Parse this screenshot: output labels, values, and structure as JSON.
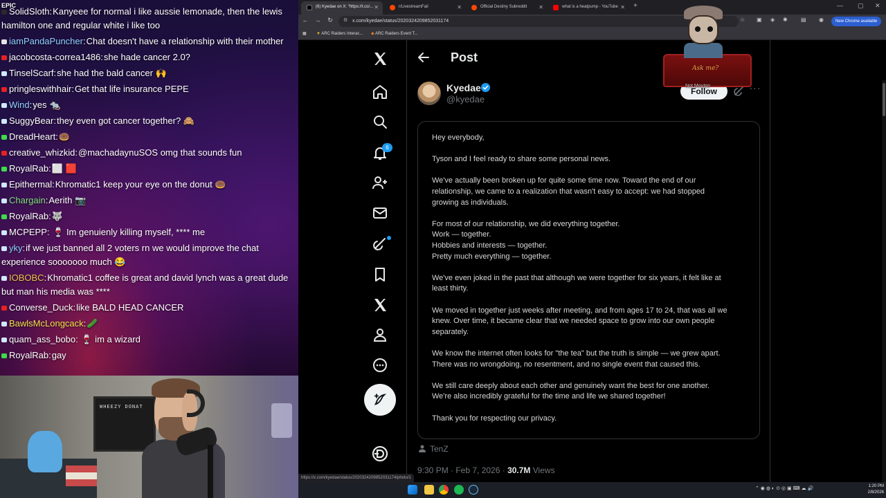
{
  "chat": {
    "badge": "EPIC\nEpic Games",
    "messages": [
      {
        "user": "SolidSloth",
        "text": "Kanyeee for normal i like aussie lemonade, then the lewis hamilton one and regular white i like too",
        "user_color": "#ffffff",
        "dot_color": "#2a2a2a"
      },
      {
        "user": "iamPandaPuncher",
        "text": "Chat doesn't have a relationship with their mother",
        "user_color": "#8fd0ff",
        "dot_color": "#e4e4e4"
      },
      {
        "user": "jacobcosta-correa1486",
        "text": "she hade cancer 2.0?",
        "user_color": "#ffffff",
        "dot_color": "#e52222"
      },
      {
        "user": "TinselScarf",
        "text": "she had the bald cancer 🙌",
        "user_color": "#ffffff",
        "dot_color": "#cfe9ff"
      },
      {
        "user": "pringleswithhair",
        "text": "Get that life insurance PEPE",
        "user_color": "#ffffff",
        "dot_color": "#e52222"
      },
      {
        "user": "Wind",
        "text": "yes 🐀",
        "user_color": "#8fd0ff",
        "dot_color": "#cfe9ff"
      },
      {
        "user": "SuggyBear",
        "text": "they even got cancer together? 🙈",
        "user_color": "#ffffff",
        "dot_color": "#cfe9ff"
      },
      {
        "user": "DreadHeart",
        "text": "🍩",
        "user_color": "#ffffff",
        "dot_color": "#3ddc4a"
      },
      {
        "user": "creative_whizkid",
        "text": "@machadaynuSOS omg that sounds fun",
        "user_color": "#ffffff",
        "dot_color": "#e52222"
      },
      {
        "user": "RoyalRab",
        "text": "⬜ 🟥",
        "user_color": "#ffffff",
        "dot_color": "#3ddc4a"
      },
      {
        "user": "Epithermal",
        "text": "Khromatic1 keep your eye on the donut 🍩",
        "user_color": "#ffffff",
        "dot_color": "#cfe9ff"
      },
      {
        "user": "Chargain",
        "text": "Aerith 📷",
        "user_color": "#7fe07f",
        "dot_color": "#cfe9ff"
      },
      {
        "user": "RoyalRab",
        "text": "🐺",
        "user_color": "#ffffff",
        "dot_color": "#3ddc4a"
      },
      {
        "user": "MCPEPP",
        "text": " 🍷 Im genuienly killing myself, **** me",
        "user_color": "#ffffff",
        "dot_color": "#cfe9ff"
      },
      {
        "user": "yky",
        "text": "if we just banned all 2 voters rn we would improve the chat experience sooooooo much 😂",
        "user_color": "#8fd0ff",
        "dot_color": "#cfe9ff"
      },
      {
        "user": "IOBOBC",
        "text": "Khromatic1 coffee is great and david lynch was a great dude but man his media was ****",
        "user_color": "#f0c14b",
        "dot_color": "#cfe9ff"
      },
      {
        "user": "Converse_Duck",
        "text": "like BALD HEAD CANCER",
        "user_color": "#ffffff",
        "dot_color": "#e52222"
      },
      {
        "user": "BawlsMcLongcack",
        "text": "🥒",
        "user_color": "#f0e14b",
        "dot_color": "#cfe9ff"
      },
      {
        "user": "quam_ass_bobo",
        "text": " 🍷 im a wizard",
        "user_color": "#ffffff",
        "dot_color": "#cfe9ff"
      },
      {
        "user": "RoyalRab",
        "text": "gay",
        "user_color": "#ffffff",
        "dot_color": "#3ddc4a"
      }
    ]
  },
  "webcam": {
    "board_text": "WHEEZY DONAT"
  },
  "browser": {
    "tabs": [
      {
        "title": "(6) Kyedae on X: \"https://t.co/...",
        "fav_color": "#000000",
        "active": true
      },
      {
        "title": "r/LivestreamFail",
        "fav_color": "#ff4500",
        "active": false
      },
      {
        "title": "Official Destiny Subreddit",
        "fav_color": "#ff4500",
        "active": false
      },
      {
        "title": "what is a heatpump - YouTube",
        "fav_color": "#ff0000",
        "active": false
      }
    ],
    "new_tab": "+",
    "window_controls": [
      "—",
      "▢",
      "✕"
    ],
    "url": "x.com/kyedae/status/2020324209852031174",
    "new_chrome": "New Chrome available",
    "bookmarks": [
      "ARC Raiders Interac...",
      "ARC Raiders Event T..."
    ],
    "status_url": "https://x.com/kyedae/status/2020324209852031174/photo/1"
  },
  "x": {
    "nav": {
      "notifications_count": "6"
    },
    "header": {
      "title": "Post"
    },
    "author": {
      "name": "Kyedae",
      "handle": "@kyedae",
      "follow_label": "Follow"
    },
    "statement_lines": [
      "Hey everybody,",
      "",
      "Tyson and I feel ready to share some personal news.",
      "",
      "We've actually been broken up for quite some time now. Toward the end of our",
      "relationship, we came to a realization that wasn't easy to accept: we had stopped",
      "growing as individuals.",
      "",
      "For most of our relationship, we did everything together.",
      "Work — together.",
      "Hobbies and interests — together.",
      "Pretty much everything — together.",
      "",
      "We've even joked in the past that although we were together for six years, it felt like at",
      "least thirty.",
      "",
      "We moved in together just weeks after meeting, and from ages 17 to 24, that was all we",
      "knew. Over time, it became clear that we needed space to grow into our own people",
      "separately.",
      "",
      "We know the internet often looks for \"the tea\" but the truth is simple — we grew apart.",
      "There was no wrongdoing, no resentment, and no single event that caused this.",
      "",
      "We still care deeply about each other and genuinely want the best for one another.",
      "We're also incredibly grateful for the time and life we shared together!",
      "",
      "Thank you for respecting our privacy."
    ],
    "tagged_user": "TenZ",
    "timestamp": "9:30 PM · Feb 7, 2026 · ",
    "views_count": "30.7M",
    "views_label": " Views"
  },
  "overlay": {
    "podium_text": "Ask me?",
    "label": "Not Mouton"
  },
  "taskbar": {
    "time": "1:20 PM",
    "date": "2/8/2026"
  },
  "colors": {
    "x_blue": "#1d9bf0",
    "x_text": "#e7e9ea",
    "x_muted": "#71767b",
    "x_border": "#2f3336"
  }
}
